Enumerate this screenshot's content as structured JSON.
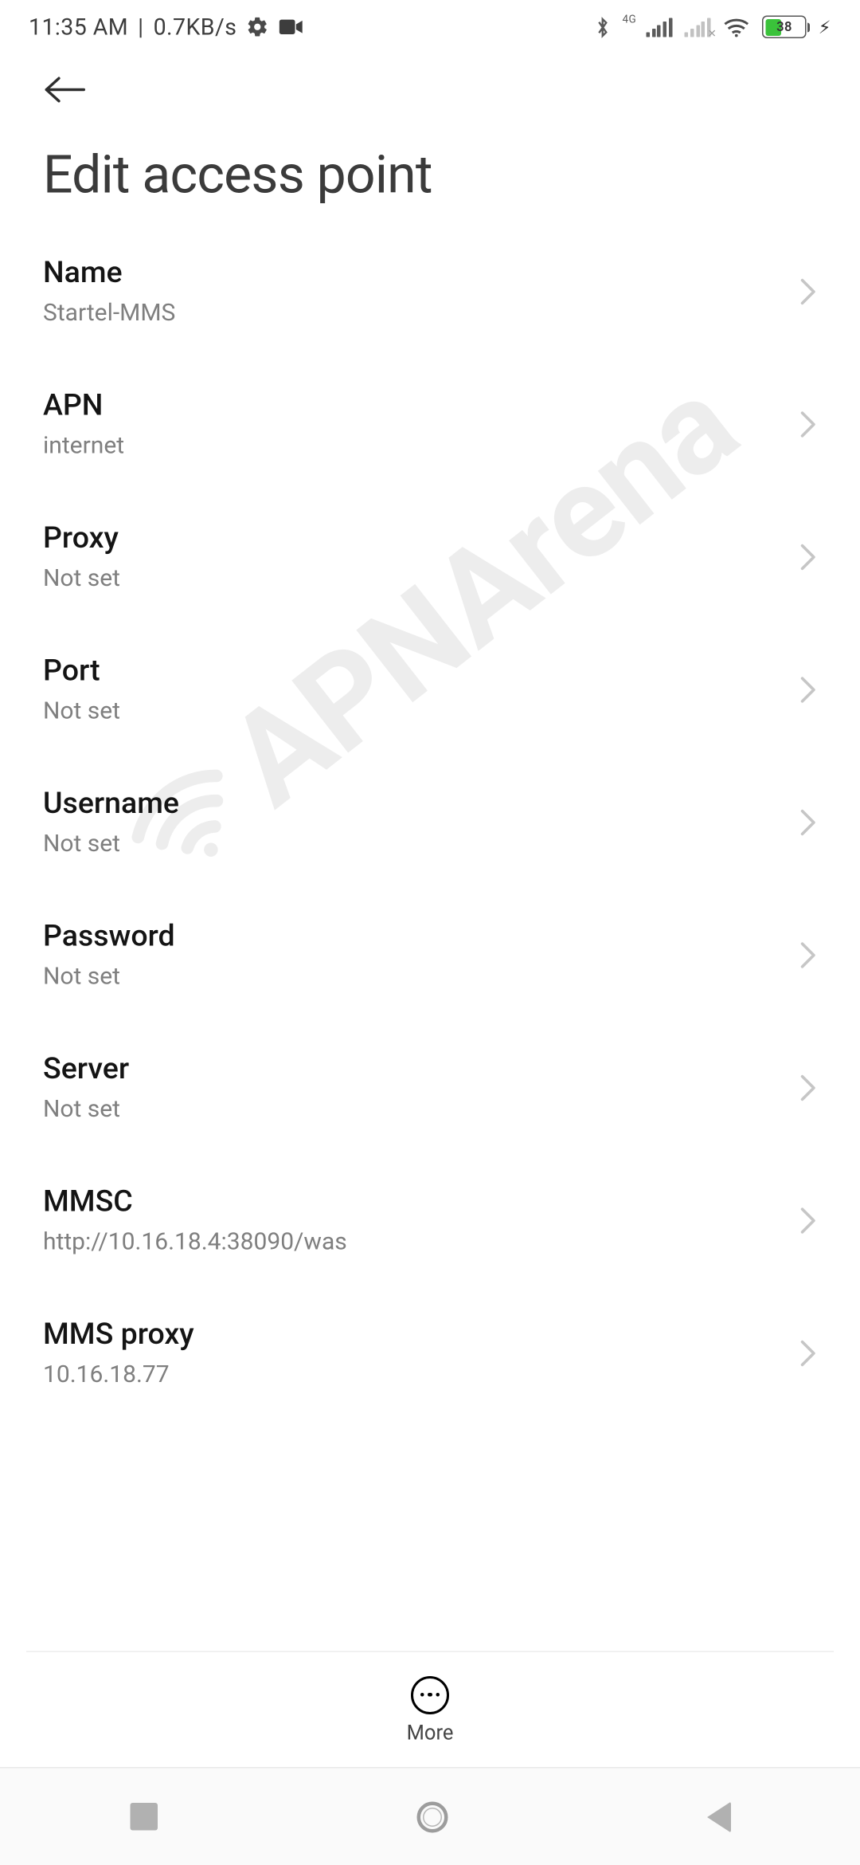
{
  "status": {
    "time": "11:35 AM",
    "net_speed": "0.7KB/s",
    "battery_pct": "38",
    "cell_label": "4G"
  },
  "header": {
    "title": "Edit access point"
  },
  "watermark": "APNArena",
  "more_label": "More",
  "fields": [
    {
      "label": "Name",
      "value": "Startel-MMS"
    },
    {
      "label": "APN",
      "value": "internet"
    },
    {
      "label": "Proxy",
      "value": "Not set"
    },
    {
      "label": "Port",
      "value": "Not set"
    },
    {
      "label": "Username",
      "value": "Not set"
    },
    {
      "label": "Password",
      "value": "Not set"
    },
    {
      "label": "Server",
      "value": "Not set"
    },
    {
      "label": "MMSC",
      "value": "http://10.16.18.4:38090/was"
    },
    {
      "label": "MMS proxy",
      "value": "10.16.18.77"
    }
  ]
}
